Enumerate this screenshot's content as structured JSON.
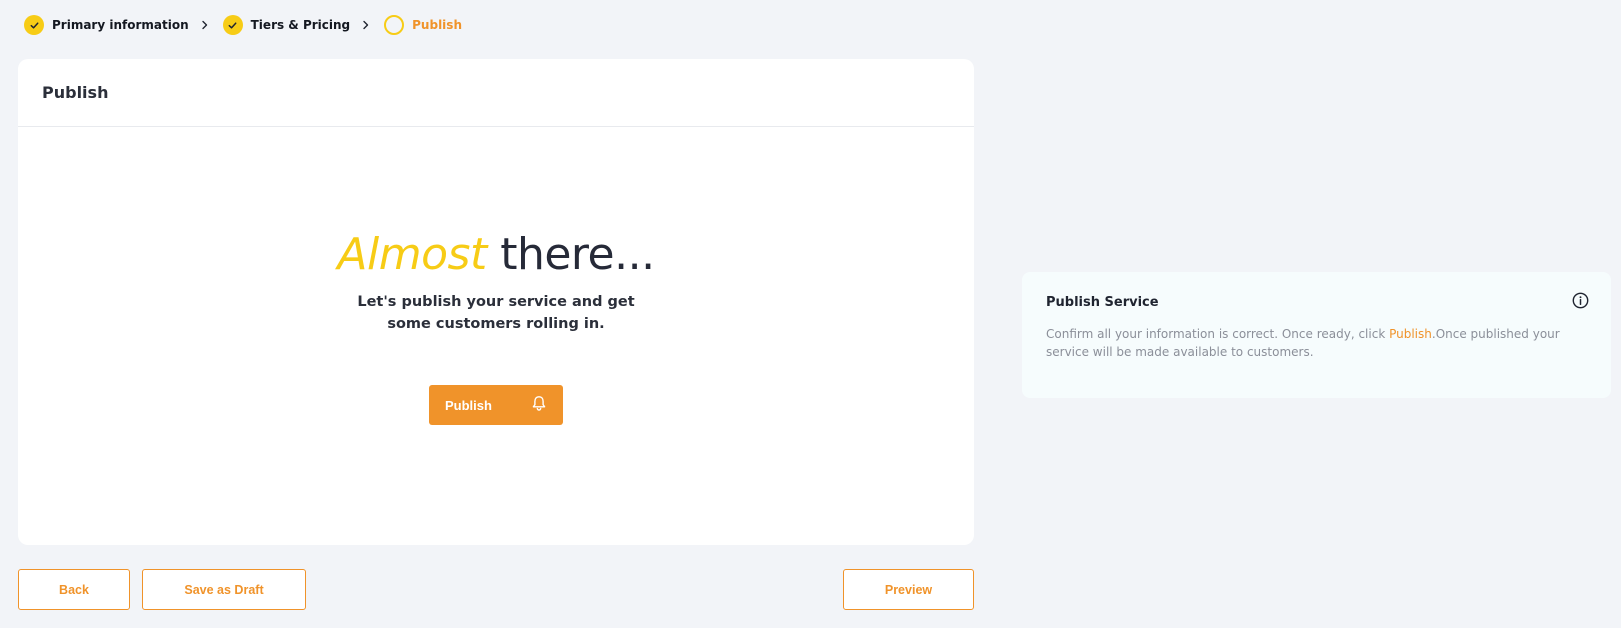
{
  "stepper": {
    "steps": [
      {
        "label": "Primary information",
        "status": "done"
      },
      {
        "label": "Tiers & Pricing",
        "status": "done"
      },
      {
        "label": "Publish",
        "status": "current"
      }
    ]
  },
  "card": {
    "title": "Publish",
    "hero": {
      "title_em": "Almost",
      "title_rest": " there...",
      "subtitle": "Let's publish your service and get some customers rolling in."
    },
    "publish_button": {
      "label": "Publish",
      "icon": "bell-icon"
    }
  },
  "footer": {
    "back_label": "Back",
    "draft_label": "Save as Draft",
    "preview_label": "Preview"
  },
  "info_panel": {
    "title": "Publish Service",
    "icon": "info-icon",
    "text_before": "Confirm all your information is correct. Once ready, click ",
    "text_highlight": "Publish",
    "text_after": ".Once published your service will be made available to customers."
  },
  "colors": {
    "accent_orange": "#f0932a",
    "accent_yellow": "#f7cc16",
    "background": "#f2f4f8",
    "info_background": "#f6fcfd"
  }
}
